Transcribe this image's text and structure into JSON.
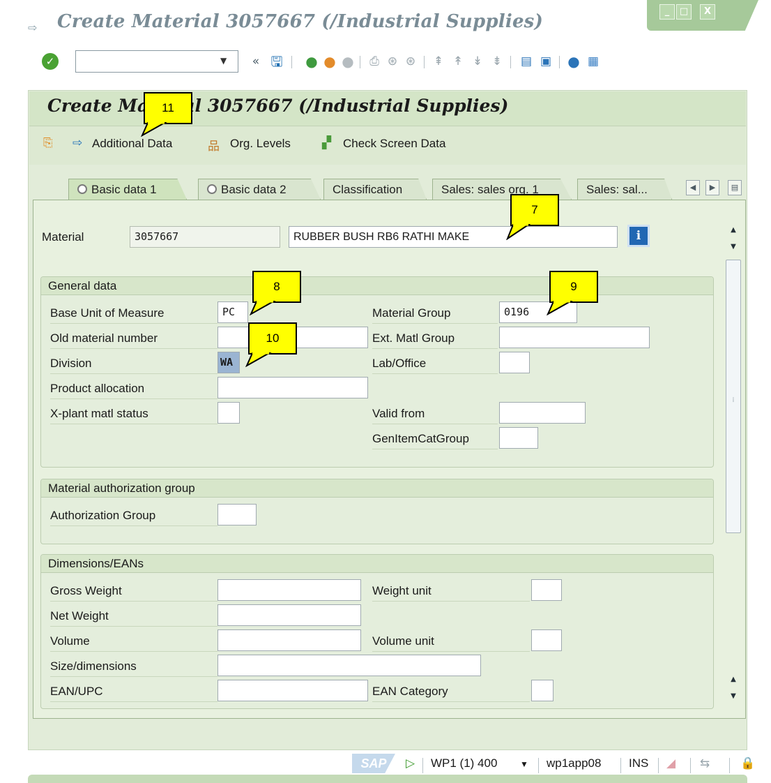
{
  "window": {
    "title": "Create Material 3057667 (/Industrial Supplies)",
    "controls": [
      "_",
      "□",
      "X"
    ]
  },
  "toolbar": {
    "ok_icon": "check-circle-icon",
    "command_field_value": "",
    "back_chevron": "«",
    "icons": [
      "save-icon",
      "back-icon",
      "exit-icon",
      "cancel-icon",
      "print-icon",
      "find-icon",
      "find-next-icon",
      "first-page-icon",
      "previous-page-icon",
      "next-page-icon",
      "last-page-icon",
      "create-session-icon",
      "shortcut-icon",
      "help-icon",
      "customize-layout-icon"
    ]
  },
  "screen": {
    "title": "Create Material 3057667 (/Industrial Supplies)",
    "app_buttons": [
      {
        "label": "Additional Data",
        "icon": "arrow-right-icon"
      },
      {
        "label": "Org. Levels",
        "icon": "org-levels-icon"
      },
      {
        "label": "Check Screen Data",
        "icon": "check-screen-icon"
      }
    ]
  },
  "tabs": [
    {
      "label": "Basic data 1",
      "active": true
    },
    {
      "label": "Basic data 2",
      "active": false
    },
    {
      "label": "Classification",
      "active": false
    },
    {
      "label": "Sales: sales org. 1",
      "active": false
    },
    {
      "label": "Sales: sal...",
      "active": false
    }
  ],
  "material": {
    "label": "Material",
    "number": "3057667",
    "description": "RUBBER BUSH RB6 RATHI MAKE"
  },
  "general_data": {
    "title": "General data",
    "base_uom": {
      "label": "Base Unit of Measure",
      "value": "PC"
    },
    "old_material": {
      "label": "Old material number",
      "value": ""
    },
    "division": {
      "label": "Division",
      "value": "WA"
    },
    "product_allocation": {
      "label": "Product allocation",
      "value": ""
    },
    "xplant_status": {
      "label": "X-plant matl status",
      "value": ""
    },
    "material_group": {
      "label": "Material Group",
      "value": "0196"
    },
    "ext_matl_group": {
      "label": "Ext. Matl Group",
      "value": ""
    },
    "lab_office": {
      "label": "Lab/Office",
      "value": ""
    },
    "valid_from": {
      "label": "Valid from",
      "value": ""
    },
    "gen_item_cat_group": {
      "label": "GenItemCatGroup",
      "value": ""
    }
  },
  "auth_group": {
    "title": "Material authorization group",
    "authorization_group": {
      "label": "Authorization Group",
      "value": ""
    }
  },
  "dimensions": {
    "title": "Dimensions/EANs",
    "gross_weight": {
      "label": "Gross Weight",
      "value": ""
    },
    "net_weight": {
      "label": "Net Weight",
      "value": ""
    },
    "volume": {
      "label": "Volume",
      "value": ""
    },
    "size_dimensions": {
      "label": "Size/dimensions",
      "value": ""
    },
    "ean_upc": {
      "label": "EAN/UPC",
      "value": ""
    },
    "weight_unit": {
      "label": "Weight unit",
      "value": ""
    },
    "volume_unit": {
      "label": "Volume unit",
      "value": ""
    },
    "ean_category": {
      "label": "EAN Category",
      "value": ""
    }
  },
  "callouts": [
    "11",
    "7",
    "8",
    "9",
    "10"
  ],
  "status_bar": {
    "logo": "SAP",
    "system": "WP1 (1) 400",
    "server": "wp1app08",
    "mode": "INS"
  },
  "colors": {
    "panel_bg": "#e2ecd9",
    "header_bg": "#d4e5c7",
    "callout_bg": "#ffff00",
    "window_controls": "#a6c99a",
    "highlight_field": "#9ab4d2"
  }
}
